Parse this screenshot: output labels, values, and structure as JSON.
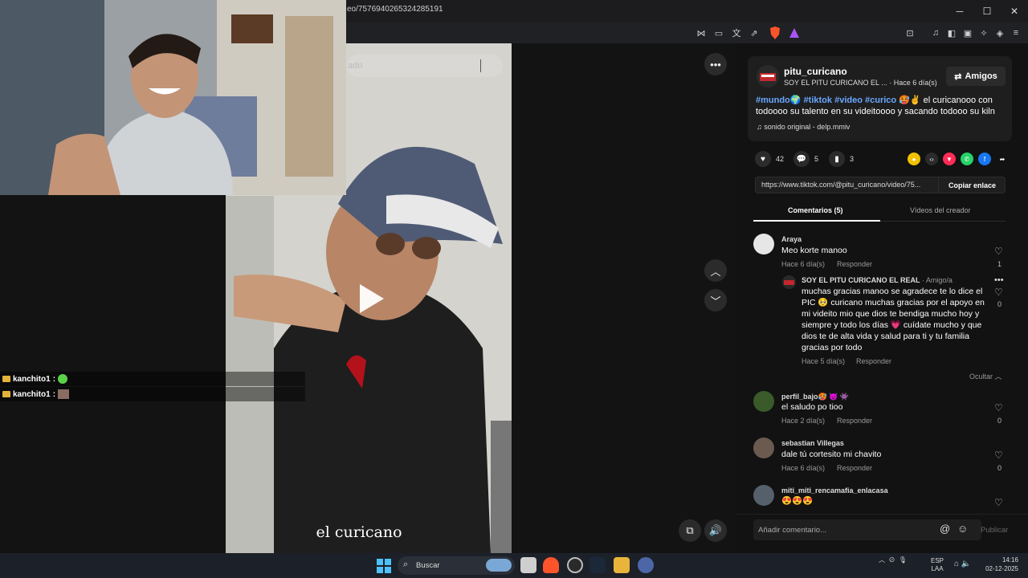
{
  "browser": {
    "url": "eo/7576940265324285191",
    "window_controls": [
      "─",
      "☐",
      "✕"
    ]
  },
  "video": {
    "search_placeholder": "ado",
    "caption": "el curicano"
  },
  "chat": [
    {
      "user": "kanchito1",
      "separator": ":"
    },
    {
      "user": "kanchito1",
      "separator": ":"
    }
  ],
  "post": {
    "username": "pitu_curicano",
    "display_name": "SOY EL PITU CURICANO EL ...",
    "time": "· Hace 6 día(s)",
    "follow_label": "Amigos",
    "hashtags": [
      "#mundo",
      "#tiktok",
      "#video",
      "#curico"
    ],
    "description": "el curicanooo con todoooo su talento en su videitoooo y sacando todooo su kiln",
    "sound": "sonido original - delp.mmiv",
    "likes": "42",
    "comments": "5",
    "saves": "3",
    "link": "https://www.tiktok.com/@pitu_curicano/video/75...",
    "copy_label": "Copiar enlace"
  },
  "tabs": {
    "comments": "Comentarios (5)",
    "creator_videos": "Vídeos del creador"
  },
  "comments": [
    {
      "name": "Araya",
      "text": "Meo korte manoo",
      "time": "Hace 6 día(s)",
      "reply": "Responder",
      "likes": "1"
    },
    {
      "name": "SOY EL PITU CURICANO EL REAL",
      "badge": "· Amigo/a",
      "text": "muchas gracias manoo se agradece te lo dice el PIC 🥺 curicano muchas gracias por el apoyo en mi videito mio que dios te bendiga mucho hoy y siempre y todo los días 💗 cuídate mucho y que dios te de alta vida y salud para ti y tu familia gracias por todo",
      "time": "Hace 5 día(s)",
      "reply": "Responder",
      "likes": "0"
    },
    {
      "name": "perfil_bajo🥵 👿 👾",
      "text": "el saludo po tioo",
      "time": "Hace 2 día(s)",
      "reply": "Responder",
      "likes": "0"
    },
    {
      "name": "sebastian Villegas",
      "text": "dale tú cortesito mi chavito",
      "time": "Hace 6 día(s)",
      "reply": "Responder",
      "likes": "0"
    },
    {
      "name": "miti_miti_rencamafia_enlacasa",
      "text": "😍😍😍",
      "time": "",
      "reply": "",
      "likes": ""
    }
  ],
  "hide_label": "Ocultar",
  "comment_input": {
    "placeholder": "Añadir comentario...",
    "publish": "Publicar"
  },
  "taskbar": {
    "search": "Buscar",
    "lang_line1": "ESP",
    "lang_line2": "LAA",
    "time": "14:16",
    "date": "02-12-2025"
  },
  "colors": {
    "hashtag": "#6aa7ff",
    "panel_bg": "#121212",
    "card_bg": "#1e1e1e",
    "taskbar_bg": "#1c2028",
    "accent_windows": "#4cc2ff"
  }
}
